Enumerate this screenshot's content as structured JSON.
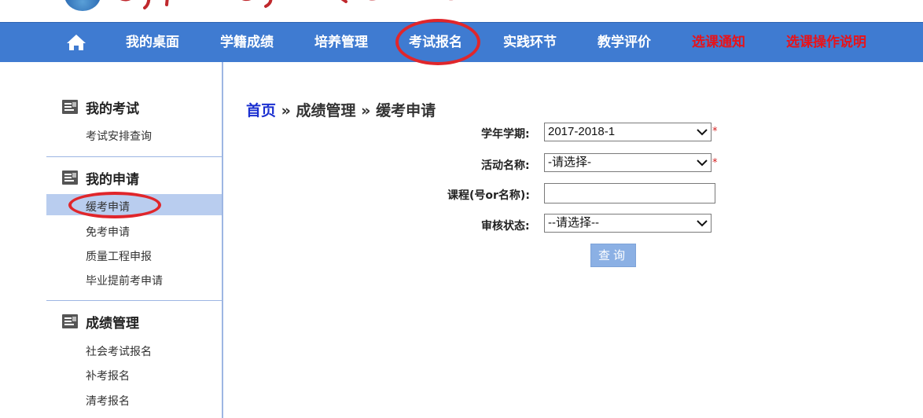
{
  "nav": {
    "home_icon": "home-icon",
    "items": [
      {
        "label": "我的桌面"
      },
      {
        "label": "学籍成绩"
      },
      {
        "label": "培养管理"
      },
      {
        "label": "考试报名"
      },
      {
        "label": "实践环节"
      },
      {
        "label": "教学评价"
      },
      {
        "label": "选课通知"
      },
      {
        "label": "选课操作说明"
      }
    ],
    "bar_color": "#3f7bd1",
    "highlight_color": "#e8131a"
  },
  "sidebar": {
    "sections": [
      {
        "title": "我的考试",
        "icon": "document-icon",
        "links": [
          "考试安排查询"
        ]
      },
      {
        "title": "我的申请",
        "icon": "document-icon",
        "links": [
          "缓考申请",
          "免考申请",
          "质量工程申报",
          "毕业提前考申请"
        ]
      },
      {
        "title": "成绩管理",
        "icon": "document-icon",
        "links": [
          "社会考试报名",
          "补考报名",
          "清考报名"
        ]
      }
    ],
    "active_link": "缓考申请"
  },
  "breadcrumb": {
    "home": "首页",
    "sep1": " » ",
    "level1": "成绩管理",
    "sep2": " » ",
    "level2": "缓考申请"
  },
  "form": {
    "term_label": "学年学期:",
    "term_value": "2017-2018-1",
    "activity_label": "活动名称:",
    "activity_value": "-请选择-",
    "course_label": "课程(号or名称):",
    "course_value": "",
    "status_label": "审核状态:",
    "status_value": "--请选择--",
    "required_mark": "*",
    "query_button": "查询"
  }
}
